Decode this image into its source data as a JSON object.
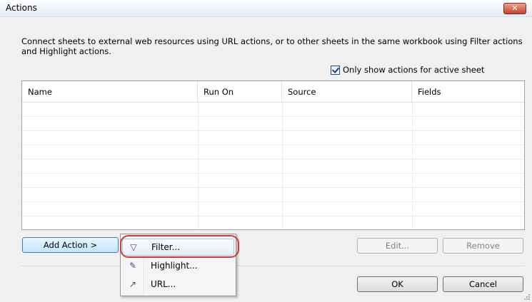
{
  "window": {
    "title": "Actions",
    "close_label": "✕"
  },
  "description": "Connect sheets to external web resources using URL actions, or to other sheets in the same workbook using Filter actions and Highlight actions.",
  "only_active": {
    "label": "Only show actions for active sheet",
    "checked": true
  },
  "table": {
    "columns": [
      "Name",
      "Run On",
      "Source",
      "Fields"
    ],
    "rows": []
  },
  "buttons": {
    "add_action": "Add Action >",
    "edit": "Edit...",
    "remove": "Remove",
    "ok": "OK",
    "cancel": "Cancel"
  },
  "menu": {
    "items": [
      {
        "label": "Filter...",
        "icon": "filter-icon",
        "glyph": "▽"
      },
      {
        "label": "Highlight...",
        "icon": "highlighter-icon",
        "glyph": "✎"
      },
      {
        "label": "URL...",
        "icon": "link-icon",
        "glyph": "↗"
      }
    ]
  },
  "colors": {
    "accent": "#3c7fb1",
    "annotation": "#d03a3a"
  }
}
